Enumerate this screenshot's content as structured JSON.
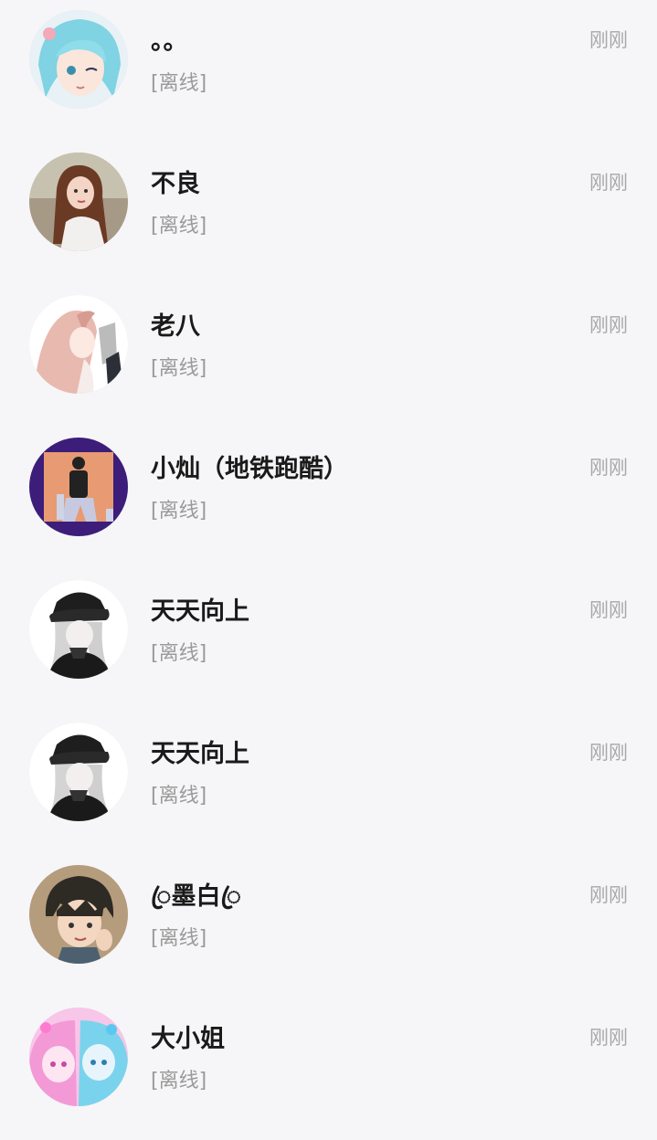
{
  "contacts": [
    {
      "name": "。。",
      "status": "[离线]",
      "time": "刚刚",
      "avatar_icon": "anime-girl-blue-hair-avatar"
    },
    {
      "name": "不良",
      "status": "[离线]",
      "time": "刚刚",
      "avatar_icon": "photo-girl-long-hair-avatar"
    },
    {
      "name": "老八",
      "status": "[离线]",
      "time": "刚刚",
      "avatar_icon": "anime-girl-pink-hair-avatar"
    },
    {
      "name": "小灿（地铁跑酷）",
      "status": "[离线]",
      "time": "刚刚",
      "avatar_icon": "subway-surfer-character-avatar"
    },
    {
      "name": "天天向上",
      "status": "[离线]",
      "time": "刚刚",
      "avatar_icon": "anime-cap-silver-hair-avatar"
    },
    {
      "name": "天天向上",
      "status": "[离线]",
      "time": "刚刚",
      "avatar_icon": "anime-cap-silver-hair-avatar"
    },
    {
      "name": "ꦿ墨白ꦿ",
      "status": "[离线]",
      "time": "刚刚",
      "avatar_icon": "anime-boy-dark-hair-avatar"
    },
    {
      "name": "大小姐",
      "status": "[离线]",
      "time": "刚刚",
      "avatar_icon": "anime-twins-pink-blue-avatar"
    }
  ]
}
